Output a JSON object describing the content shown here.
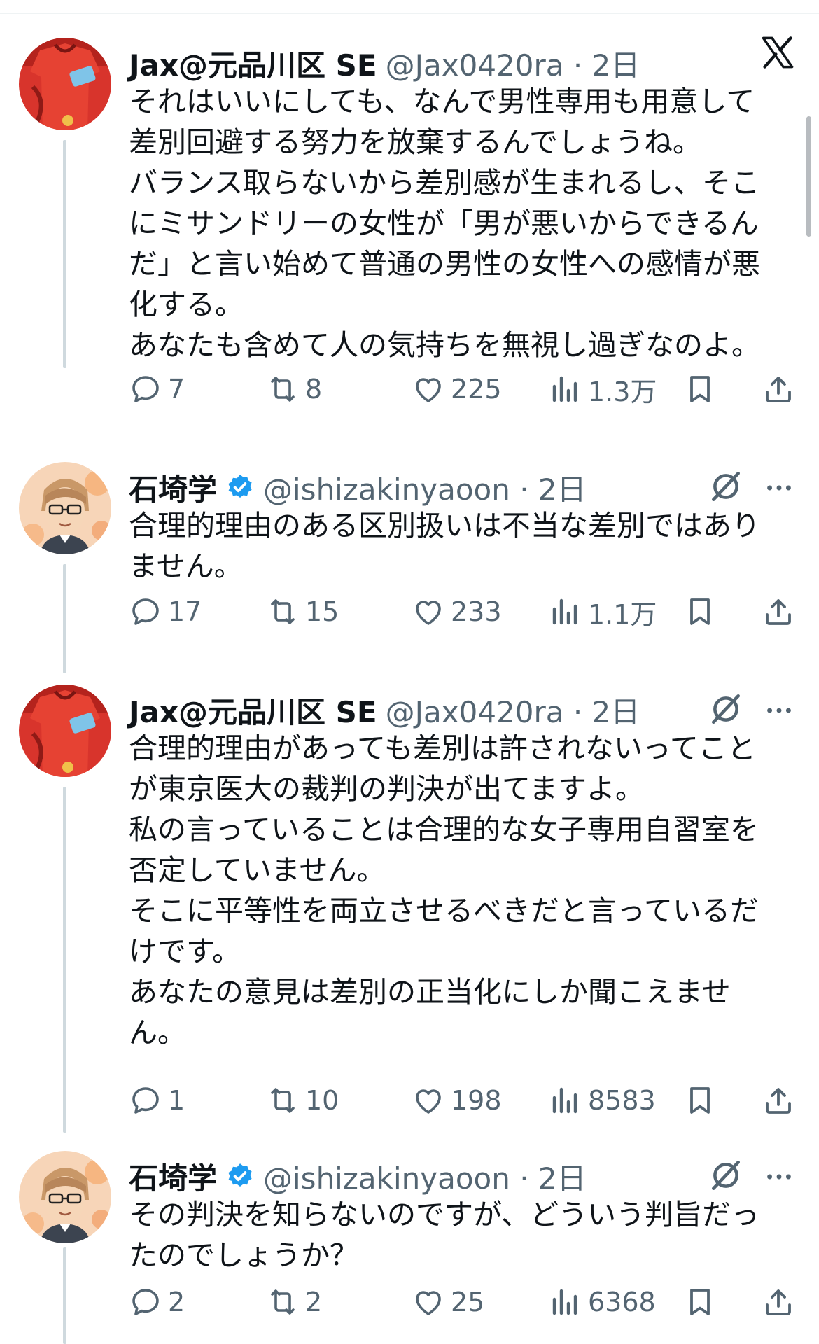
{
  "tweets": [
    {
      "name": "Jax@元品川区 SE",
      "handle": "@Jax0420ra · 2日",
      "verified": false,
      "avatar": "avatar-red-jersey",
      "body": [
        "それはいいにしても、なんで男性専用も用意して",
        "差別回避する努力を放棄するんでしょうね。",
        "バランス取らないから差別感が生まれるし、そこ",
        "にミサンドリーの女性が「男が悪いからできるん",
        "だ」と言い始めて普通の男性の女性への感情が悪",
        "化する。",
        "あなたも含めて人の気持ちを無視し過ぎなのよ。"
      ],
      "replies": "7",
      "reposts": "8",
      "likes": "225",
      "views": "1.3万"
    },
    {
      "name": "石埼学",
      "handle": "@ishizakinyaoon · 2日",
      "verified": true,
      "avatar": "avatar-caricature",
      "body": [
        "合理的理由のある区別扱いは不当な差別ではあり",
        "ません。"
      ],
      "replies": "17",
      "reposts": "15",
      "likes": "233",
      "views": "1.1万"
    },
    {
      "name": "Jax@元品川区 SE",
      "handle": "@Jax0420ra · 2日",
      "verified": false,
      "avatar": "avatar-red-jersey",
      "body": [
        "合理的理由があっても差別は許されないってこと",
        "が東京医大の裁判の判決が出てますよ。",
        "私の言っていることは合理的な女子専用自習室を",
        "否定していません。",
        "そこに平等性を両立させるべきだと言っているだ",
        "けです。",
        "あなたの意見は差別の正当化にしか聞こえませ",
        "ん。"
      ],
      "replies": "1",
      "reposts": "10",
      "likes": "198",
      "views": "8583"
    },
    {
      "name": "石埼学",
      "handle": "@ishizakinyaoon · 2日",
      "verified": true,
      "avatar": "avatar-caricature",
      "body": [
        "その判決を知らないのですが、どういう判旨だっ",
        "たのでしょうか？"
      ],
      "replies": "2",
      "reposts": "2",
      "likes": "25",
      "views": "6368"
    }
  ],
  "colors": {
    "verified": "#1d9bf0",
    "muted": "#536471",
    "thread": "#cfd9de"
  },
  "icons": [
    "x-logo-icon",
    "grok-icon",
    "more-icon",
    "reply-icon",
    "repost-icon",
    "like-icon",
    "views-icon",
    "bookmark-icon",
    "share-icon"
  ]
}
